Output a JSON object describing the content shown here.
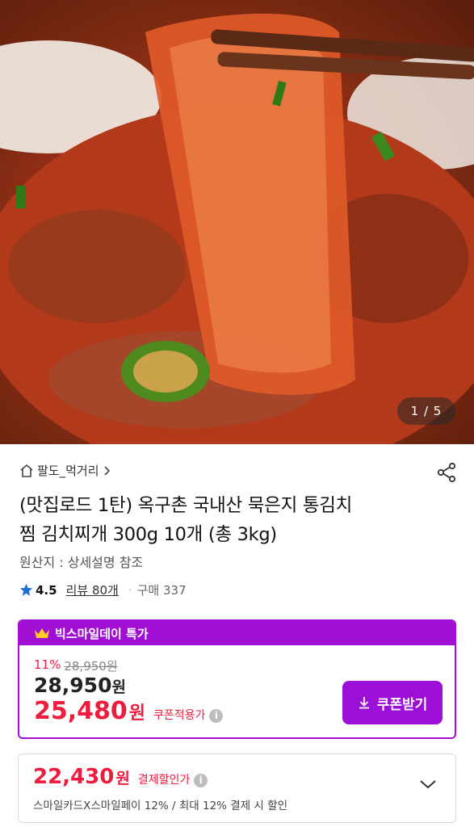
{
  "hero": {
    "page_current": "1",
    "page_total": "5",
    "page_text": "1 / 5"
  },
  "store": {
    "name": "팔도_먹거리"
  },
  "product": {
    "title_line1": "(맛집로드 1탄) 옥구촌 국내산 묵은지 통김치",
    "title_line2": "찜 김치찌개 300g 10개 (총 3kg)",
    "origin": "원산지 : 상세설명 참조",
    "rating": "4.5",
    "review_text": "리뷰 80개",
    "purchase_text": "구매 337"
  },
  "deal": {
    "badge": "빅스마일데이 특가",
    "discount_rate": "11%",
    "original_price": "28,950원",
    "price_number": "28,950",
    "price_unit": "원",
    "coupon_price_number": "25,480",
    "coupon_price_unit": "원",
    "coupon_label": "쿠폰적용가",
    "coupon_button": "쿠폰받기"
  },
  "payment": {
    "price_number": "22,430",
    "price_unit": "원",
    "label": "결제할인가",
    "description": "스마일카드X스마일페이 12% / 최대 12% 결제 시 할인"
  },
  "colors": {
    "accent_purple": "#a10fd4",
    "sale_red": "#ef1c3f",
    "star_blue": "#1f6fd6"
  }
}
